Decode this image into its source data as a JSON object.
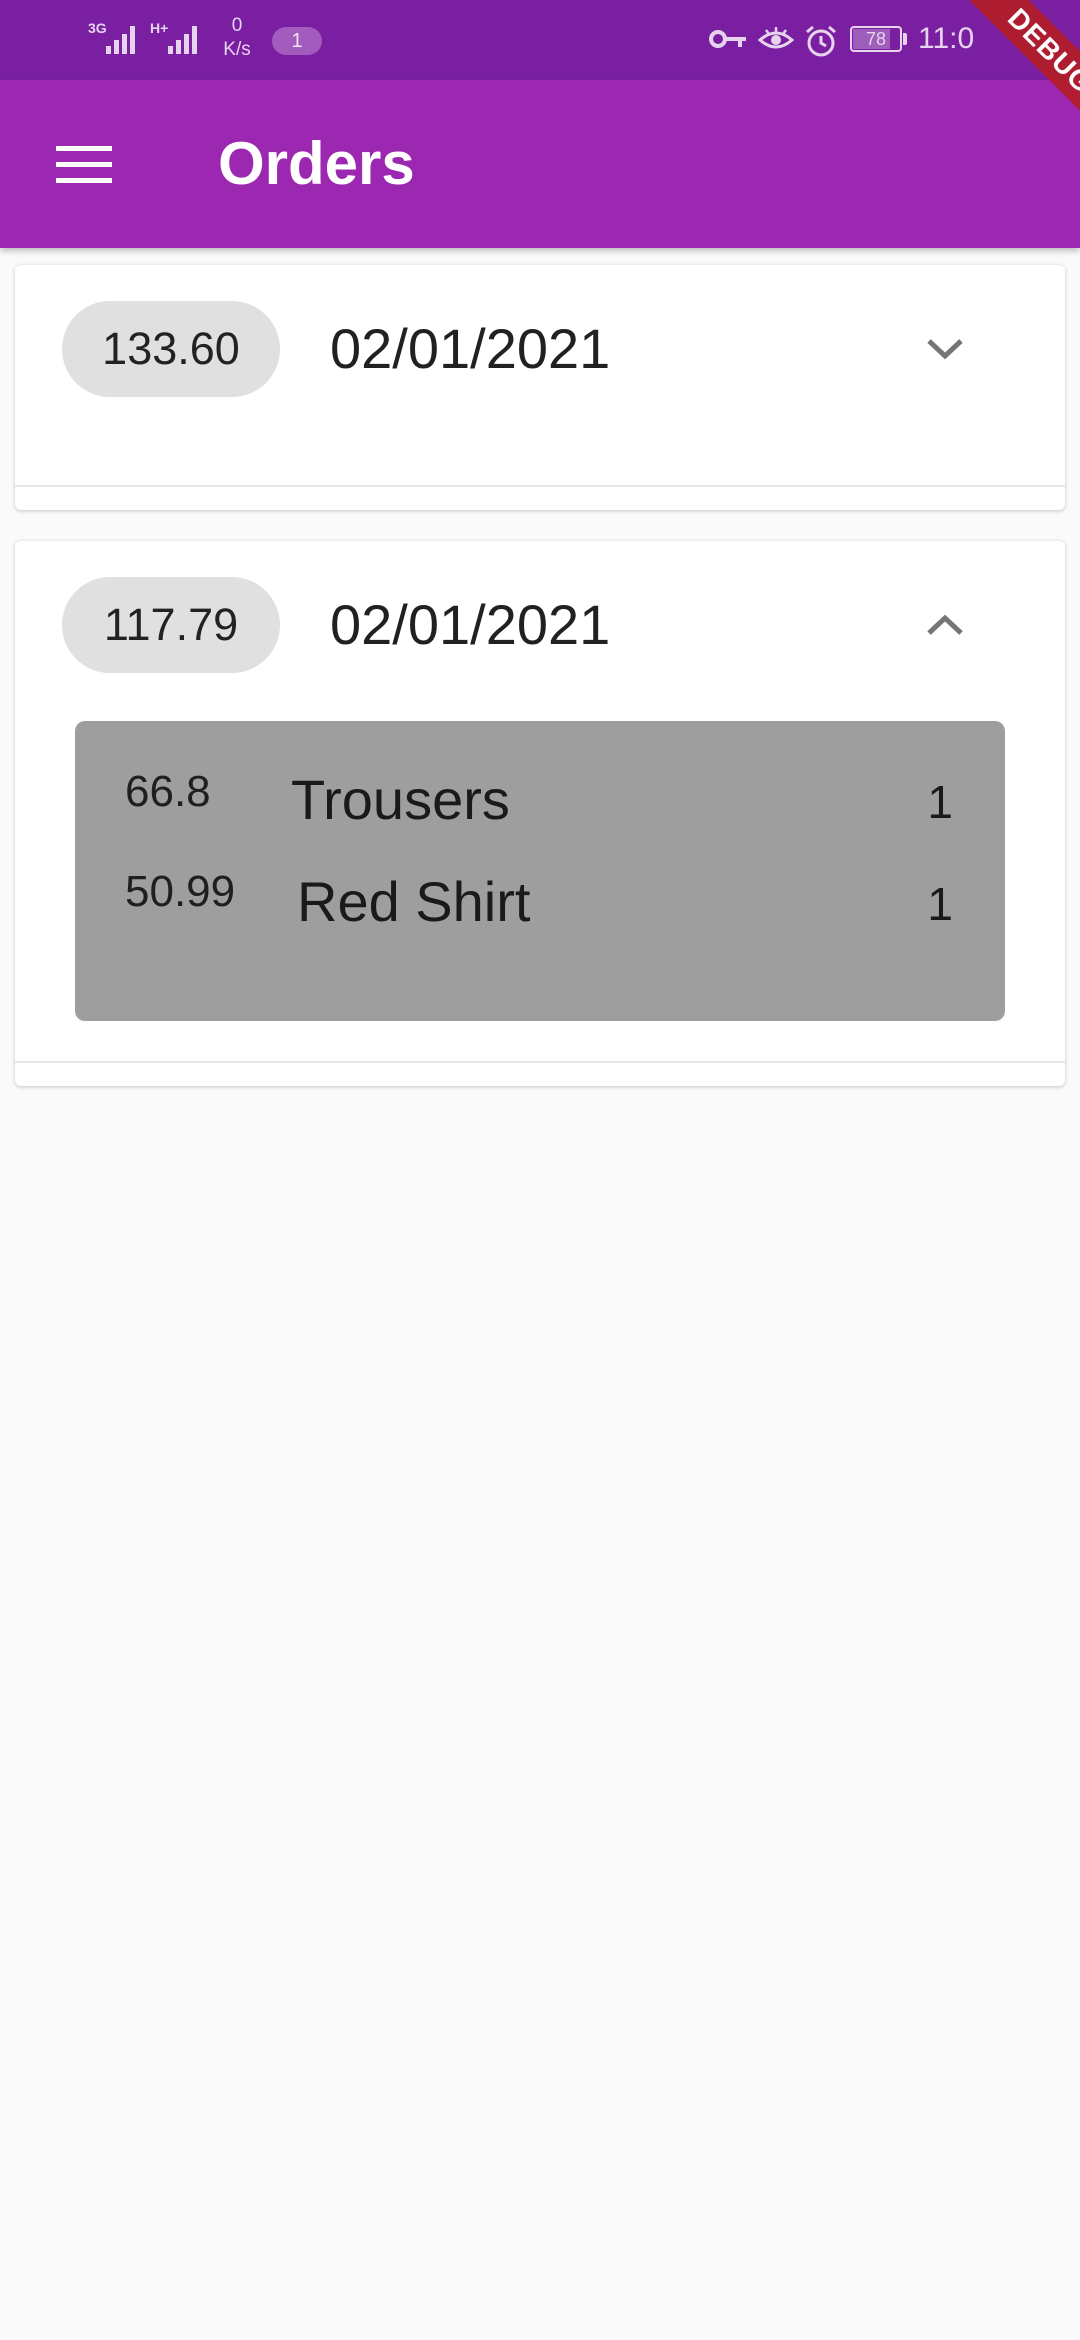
{
  "status_bar": {
    "network_1": "3G",
    "network_2": "H+",
    "speed_value": "0",
    "speed_unit": "K/s",
    "notification_count": "1",
    "battery_level": "78",
    "battery_fraction": 0.78,
    "time": "11:0",
    "icons": [
      "vpn-key-icon",
      "eye-icon",
      "alarm-icon",
      "battery-icon"
    ]
  },
  "app_bar": {
    "title": "Orders",
    "menu_icon": "hamburger-menu-icon"
  },
  "debug_banner": "DEBUG",
  "orders": [
    {
      "total": "133.60",
      "date": "02/01/2021",
      "expanded": false,
      "expand_icon": "chevron-down-icon",
      "items": []
    },
    {
      "total": "117.79",
      "date": "02/01/2021",
      "expanded": true,
      "expand_icon": "chevron-up-icon",
      "items": [
        {
          "price": "66.8",
          "title": "Trousers",
          "quantity": "1"
        },
        {
          "price": "50.99",
          "title": "Red Shirt",
          "quantity": "1"
        }
      ]
    }
  ],
  "colors": {
    "status_bar": "#7b1fa2",
    "app_bar": "#9c27b0",
    "background": "#fafafa",
    "chip": "#e0e0e0",
    "items_panel": "#9e9e9e",
    "debug_banner": "#b71c1c"
  }
}
